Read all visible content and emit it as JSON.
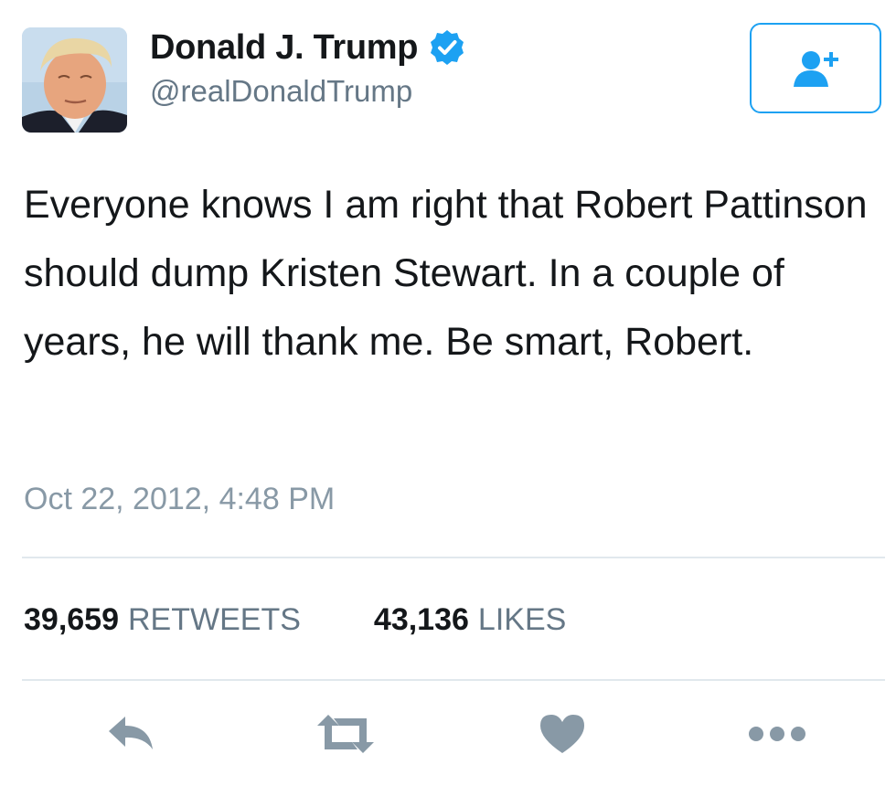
{
  "user": {
    "display_name": "Donald J. Trump",
    "handle": "@realDonaldTrump",
    "verified": true
  },
  "tweet": {
    "text": "Everyone knows I am right that Robert Pattinson should dump Kristen Stewart. In a couple of years, he will thank me. Be smart, Robert.",
    "timestamp": "Oct 22, 2012, 4:48 PM"
  },
  "stats": {
    "retweets_count": "39,659",
    "retweets_label": "RETWEETS",
    "likes_count": "43,136",
    "likes_label": "LIKES"
  },
  "actions": {
    "follow_icon": "add-user-icon",
    "reply_icon": "reply-icon",
    "retweet_icon": "retweet-icon",
    "like_icon": "heart-icon",
    "more_icon": "more-dots-icon"
  },
  "colors": {
    "brand": "#1da1f2",
    "action_icon": "#8899a6",
    "muted_text": "#657786"
  }
}
